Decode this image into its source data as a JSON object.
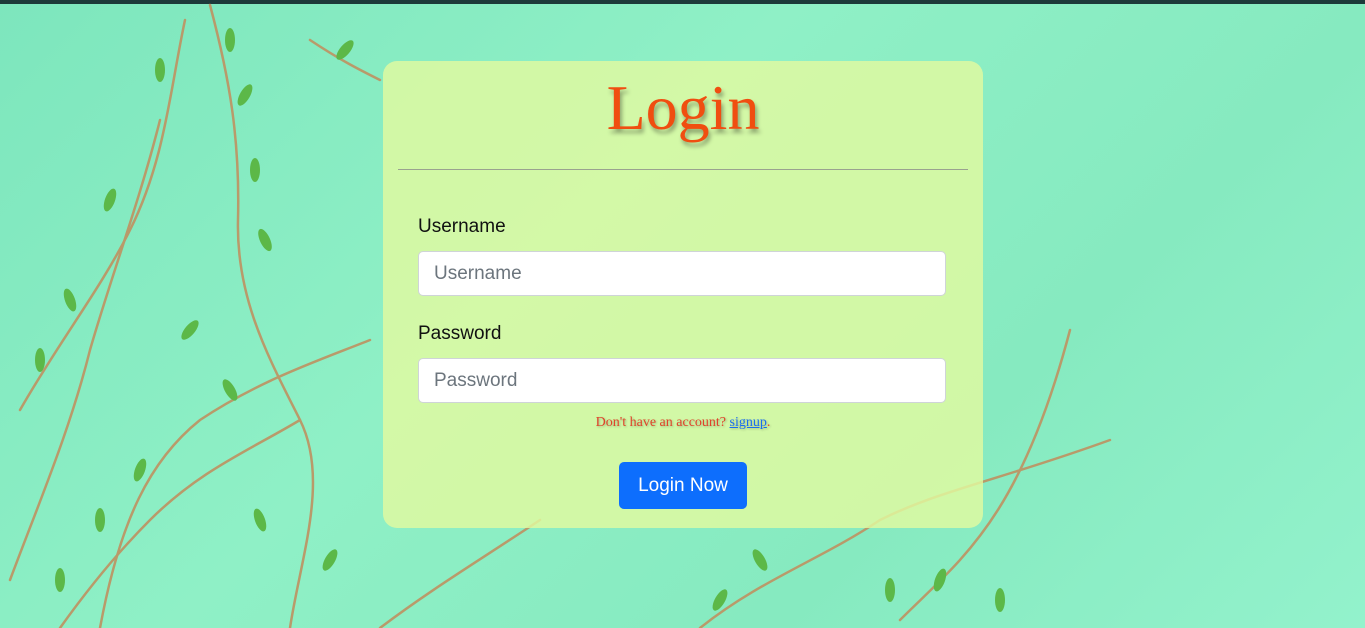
{
  "login": {
    "title": "Login",
    "username_label": "Username",
    "username_placeholder": "Username",
    "password_label": "Password",
    "password_placeholder": "Password",
    "signup_prompt": "Don't have an account? ",
    "signup_link": "signup",
    "signup_suffix": ".",
    "submit_label": "Login Now"
  },
  "colors": {
    "title": "#f04e10",
    "button": "#0d6efd",
    "card": "#e2faa0",
    "background": "#86eac0"
  }
}
